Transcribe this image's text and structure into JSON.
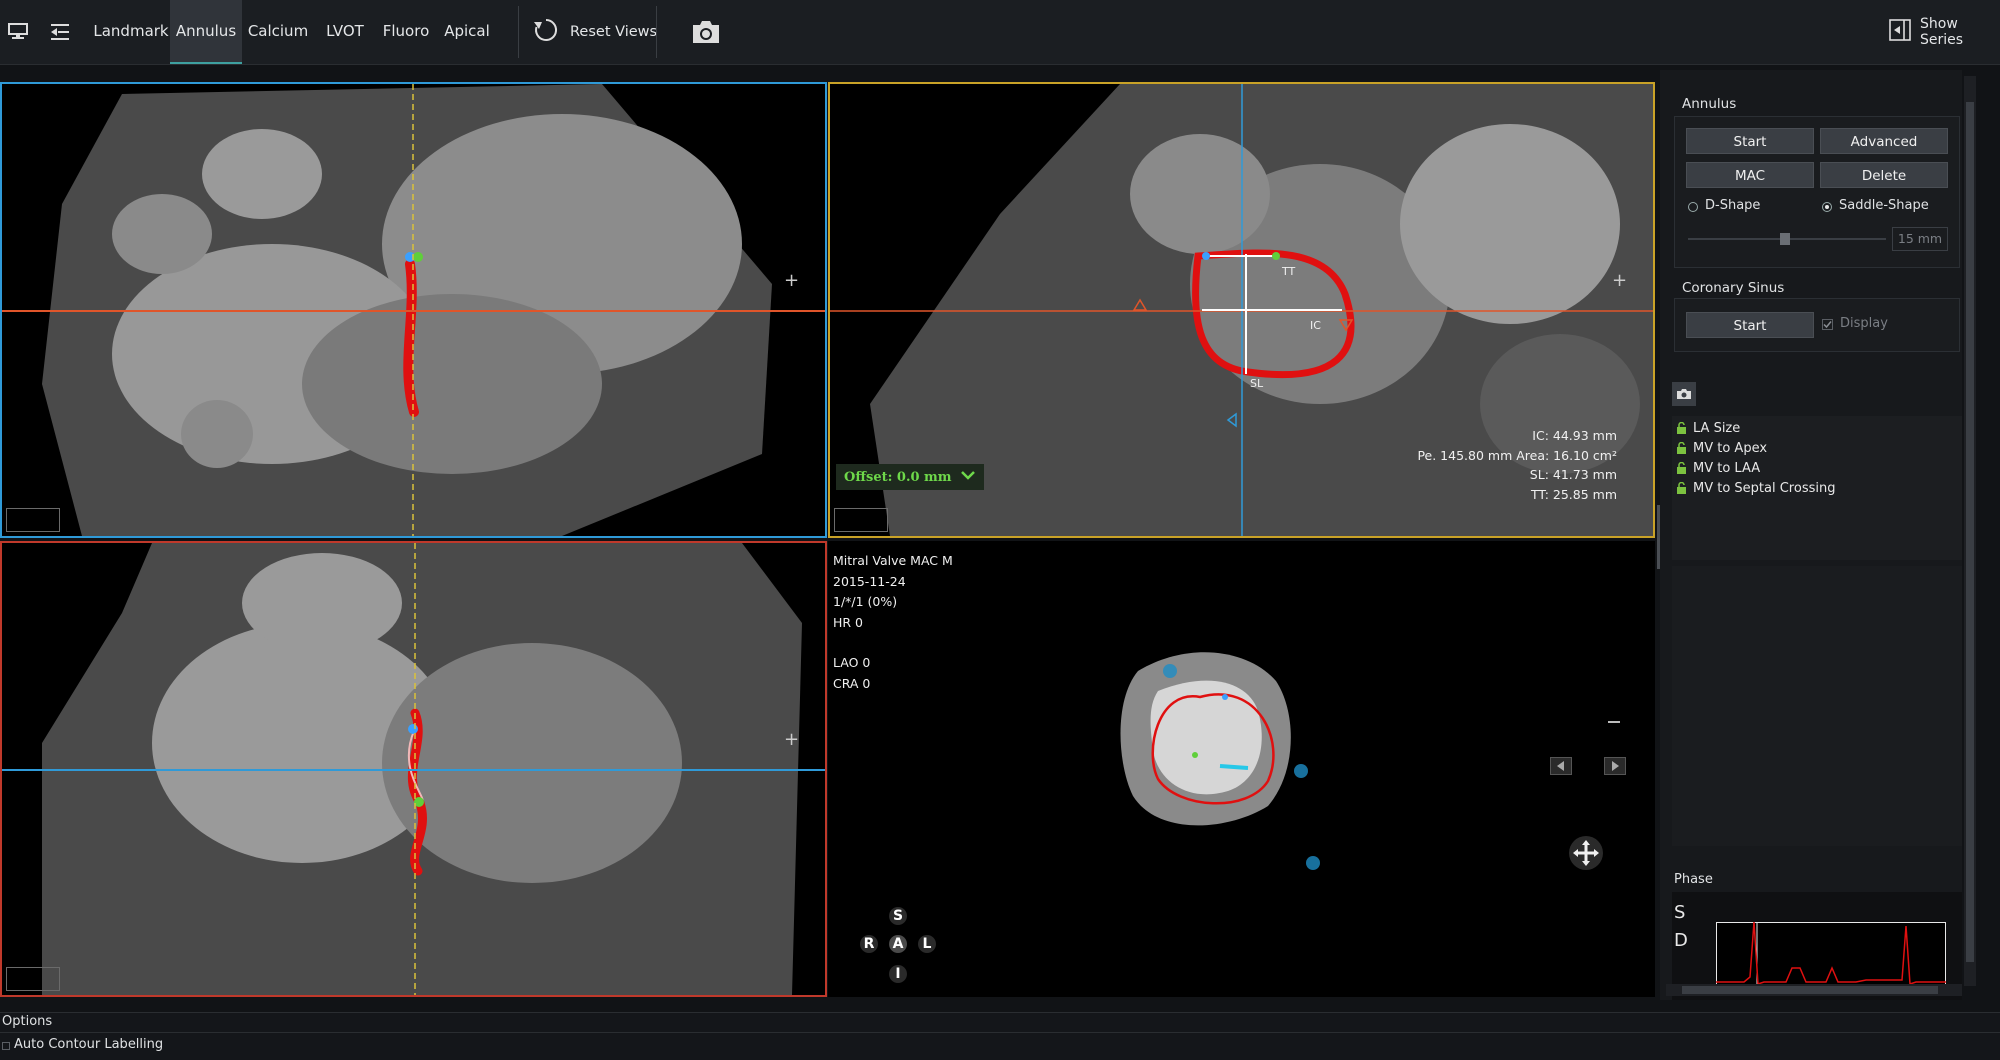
{
  "toolbar": {
    "tabs": [
      "Landmark",
      "Annulus",
      "Calcium",
      "LVOT",
      "Fluoro",
      "Apical"
    ],
    "active_tab": "Annulus",
    "reset_views": "Reset Views",
    "show_series": "Show Series"
  },
  "viewport_tr": {
    "offset": "Offset: 0.0 mm",
    "labels": {
      "tt": "TT",
      "ic": "IC",
      "sl": "SL"
    },
    "measurements": [
      "IC: 44.93 mm",
      "Pe. 145.80 mm Area: 16.10 cm²",
      "SL: 41.73 mm",
      "TT: 25.85 mm"
    ]
  },
  "viewport_br": {
    "info": [
      "Mitral Valve MAC  M",
      "2015-11-24",
      "1/*/1 (0%)",
      "HR 0"
    ],
    "angles": [
      "LAO 0",
      "CRA 0"
    ],
    "orientation": {
      "s": "S",
      "r": "R",
      "a": "A",
      "l": "L",
      "i": "I"
    }
  },
  "panel": {
    "annulus_title": "Annulus",
    "start": "Start",
    "advanced": "Advanced",
    "mac": "MAC",
    "delete": "Delete",
    "d_shape": "D-Shape",
    "saddle_shape": "Saddle-Shape",
    "thickness": "15 mm",
    "cs_title": "Coronary Sinus",
    "cs_start": "Start",
    "display": "Display",
    "measurements_list": [
      "LA Size",
      "MV to Apex",
      "MV to LAA",
      "MV to Septal Crossing"
    ],
    "phase_title": "Phase",
    "phase_s": "S",
    "phase_d": "D"
  },
  "bottom": {
    "options": "Options",
    "auto_contour": "Auto Contour Labelling"
  },
  "colors": {
    "viewport_tl_border": "#2f9ad8",
    "viewport_tr_border": "#c9a227",
    "viewport_bl_border": "#c0392b",
    "accent": "#3ea0a0",
    "contour": "#e01010"
  }
}
